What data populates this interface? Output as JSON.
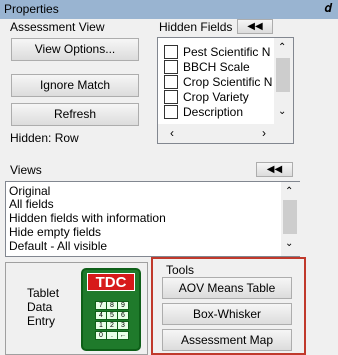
{
  "window": {
    "title": "Properties",
    "pin_glyph": "ᵖ"
  },
  "assessment_view": {
    "header": "Assessment View",
    "buttons": {
      "view_options": "View Options...",
      "ignore_match": "Ignore Match",
      "refresh": "Refresh"
    },
    "hidden_label": "Hidden: Row"
  },
  "hidden_fields": {
    "header": "Hidden Fields",
    "items": [
      "Pest Scientific N",
      "BBCH Scale",
      "Crop Scientific N",
      "Crop Variety",
      "Description"
    ]
  },
  "views": {
    "header": "Views",
    "items": [
      "Original",
      "All fields",
      "Hidden fields with information",
      "Hide empty fields",
      "Default - All visible"
    ]
  },
  "tablet": {
    "label_lines": [
      "Tablet",
      "Data",
      "Entry"
    ],
    "logo_text": "TDC",
    "keys": [
      "7",
      "8",
      "9",
      "4",
      "5",
      "6",
      "1",
      "2",
      "3",
      "0",
      ".",
      "←"
    ]
  },
  "tools": {
    "header": "Tools",
    "buttons": [
      "AOV Means Table",
      "Box-Whisker",
      "Assessment Map"
    ]
  },
  "colors": {
    "highlight_frame": "#c0392b",
    "titlebar": "#99b4d1"
  }
}
